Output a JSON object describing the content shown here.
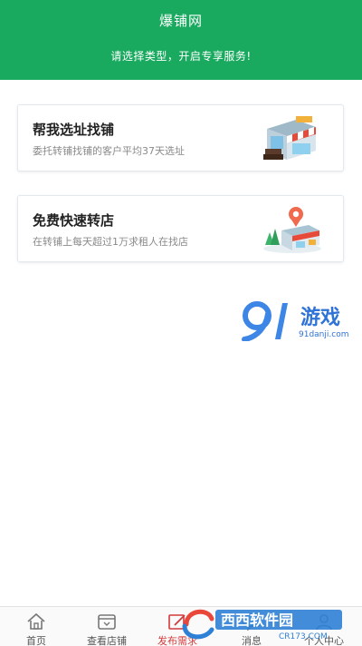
{
  "header": {
    "title": "爆铺网",
    "subtitle": "请选择类型，开启专享服务!"
  },
  "cards": [
    {
      "title": "帮我选址找铺",
      "desc": "委托转铺找铺的客户平均37天选址",
      "icon": "shop-storefront-icon"
    },
    {
      "title": "免费快速转店",
      "desc": "在转铺上每天超过1万求租人在找店",
      "icon": "shop-location-pin-icon"
    }
  ],
  "watermark": {
    "brand": "游戏",
    "url": "91danji.com",
    "brand2": "西西软件园",
    "url2": "CR173.COM"
  },
  "tabbar": {
    "items": [
      {
        "label": "首页",
        "icon": "home-icon"
      },
      {
        "label": "查看店铺",
        "icon": "shop-icon"
      },
      {
        "label": "发布需求",
        "icon": "edit-icon",
        "active": true
      },
      {
        "label": "消息",
        "icon": "message-icon"
      },
      {
        "label": "个人中心",
        "icon": "user-icon"
      }
    ]
  },
  "colors": {
    "brand_green": "#1aaa5f",
    "active_red": "#d23b3b"
  }
}
